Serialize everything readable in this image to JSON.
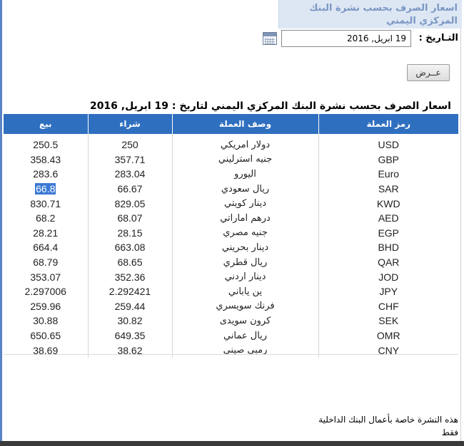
{
  "header": {
    "title_line1": "اسعار الصرف بحسب نشرة البنك",
    "title_line2": "المركزي اليمني"
  },
  "date_field": {
    "label": "التـاريخ :",
    "value": "19 ابريل, 2016",
    "icon": "calendar-icon"
  },
  "show_button": {
    "label": "عــرض"
  },
  "table": {
    "title": "اسعار الصرف بحسب نشرة البنك المركزي اليمني لتاريخ : 19 ابريل, 2016",
    "headers": {
      "sell": "بيع",
      "buy": "شراء",
      "description": "وصف العملة",
      "code": "رمز العملة"
    },
    "rows": [
      {
        "code": "USD",
        "description": "دولار امريكي",
        "buy": "250",
        "sell": "250.5"
      },
      {
        "code": "GBP",
        "description": "جنيه استرليني",
        "buy": "357.71",
        "sell": "358.43"
      },
      {
        "code": "Euro",
        "description": "اليورو",
        "buy": "283.04",
        "sell": "283.6"
      },
      {
        "code": "SAR",
        "description": "ريال سعودي",
        "buy": "66.67",
        "sell": "66.8"
      },
      {
        "code": "KWD",
        "description": "دينار كويتي",
        "buy": "829.05",
        "sell": "830.71"
      },
      {
        "code": "AED",
        "description": "درهم اماراتي",
        "buy": "68.07",
        "sell": "68.2"
      },
      {
        "code": "EGP",
        "description": "جنيه مصري",
        "buy": "28.15",
        "sell": "28.21"
      },
      {
        "code": "BHD",
        "description": "دينار بحريني",
        "buy": "663.08",
        "sell": "664.4"
      },
      {
        "code": "QAR",
        "description": "ريال قطري",
        "buy": "68.65",
        "sell": "68.79"
      },
      {
        "code": "JOD",
        "description": "دينار اردني",
        "buy": "352.36",
        "sell": "353.07"
      },
      {
        "code": "JPY",
        "description": "ين ياباني",
        "buy": "2.292421",
        "sell": "2.297006"
      },
      {
        "code": "CHF",
        "description": "فرنك سويسري",
        "buy": "259.44",
        "sell": "259.96"
      },
      {
        "code": "SEK",
        "description": "كرون سويدى",
        "buy": "30.82",
        "sell": "30.88"
      },
      {
        "code": "OMR",
        "description": "ريال عماني",
        "buy": "649.35",
        "sell": "650.65"
      },
      {
        "code": "CNY",
        "description": "رمبي صيني",
        "buy": "38.62",
        "sell": "38.69"
      }
    ],
    "highlighted_cell": {
      "row": 3,
      "column": "sell"
    }
  },
  "footnote": {
    "line1": "هذه النشرة خاصة بأعمال البنك الداخلية",
    "line2": "فقط"
  },
  "colors": {
    "header_bg": "#dde7f3",
    "header_text": "#7a96c3",
    "table_header_bg": "#2f6fbf",
    "selection": "#3b78d4"
  }
}
